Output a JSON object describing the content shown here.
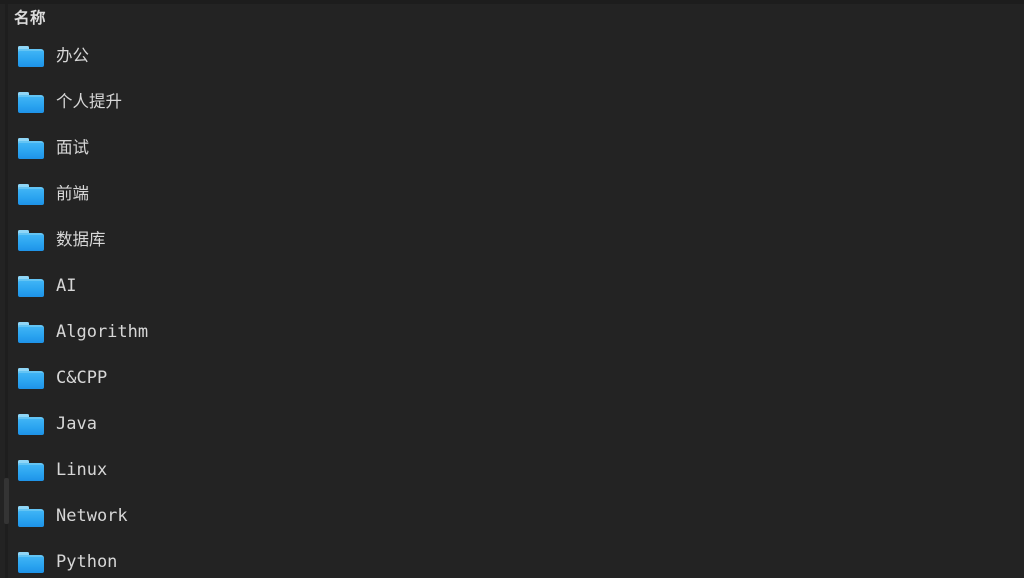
{
  "pane": {
    "background_color": "#232323",
    "text_color": "#d7d7d7",
    "accent_color": "#2aa3f0"
  },
  "header": {
    "name_column_label": "名称"
  },
  "scrollbar": {
    "orientation": "vertical",
    "thumb_color": "#343434",
    "track_color": "#1e1e1e"
  },
  "file_list": {
    "icon_name": "folder-icon",
    "items": [
      {
        "label": "办公",
        "script": "cjk"
      },
      {
        "label": "个人提升",
        "script": "cjk"
      },
      {
        "label": "面试",
        "script": "cjk"
      },
      {
        "label": "前端",
        "script": "cjk"
      },
      {
        "label": "数据库",
        "script": "cjk"
      },
      {
        "label": "AI",
        "script": "latin"
      },
      {
        "label": "Algorithm",
        "script": "latin"
      },
      {
        "label": "C&CPP",
        "script": "latin"
      },
      {
        "label": "Java",
        "script": "latin"
      },
      {
        "label": "Linux",
        "script": "latin"
      },
      {
        "label": "Network",
        "script": "latin"
      },
      {
        "label": "Python",
        "script": "latin"
      }
    ]
  }
}
